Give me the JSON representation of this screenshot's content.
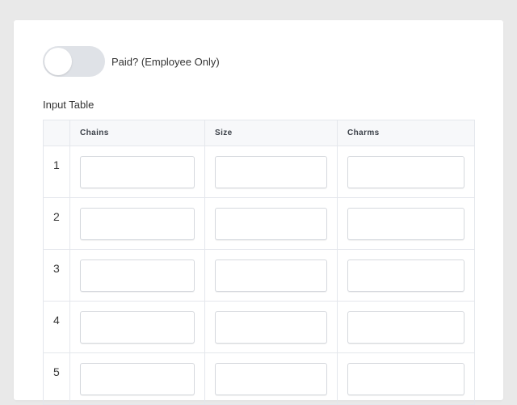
{
  "form": {
    "paid_toggle": {
      "label": "Paid? (Employee Only)",
      "checked": false
    },
    "table": {
      "title": "Input Table",
      "columns": [
        "",
        "Chains",
        "Size",
        "Charms"
      ],
      "rows": [
        {
          "num": "1",
          "chains": "",
          "size": "",
          "charms": ""
        },
        {
          "num": "2",
          "chains": "",
          "size": "",
          "charms": ""
        },
        {
          "num": "3",
          "chains": "",
          "size": "",
          "charms": ""
        },
        {
          "num": "4",
          "chains": "",
          "size": "",
          "charms": ""
        },
        {
          "num": "5",
          "chains": "",
          "size": "",
          "charms": ""
        }
      ]
    }
  },
  "colors": {
    "page_background": "#e9e9e9",
    "card_background": "#ffffff",
    "toggle_off": "#dfe2e7",
    "header_background": "#f7f8fa",
    "border": "#e4e7ec"
  }
}
